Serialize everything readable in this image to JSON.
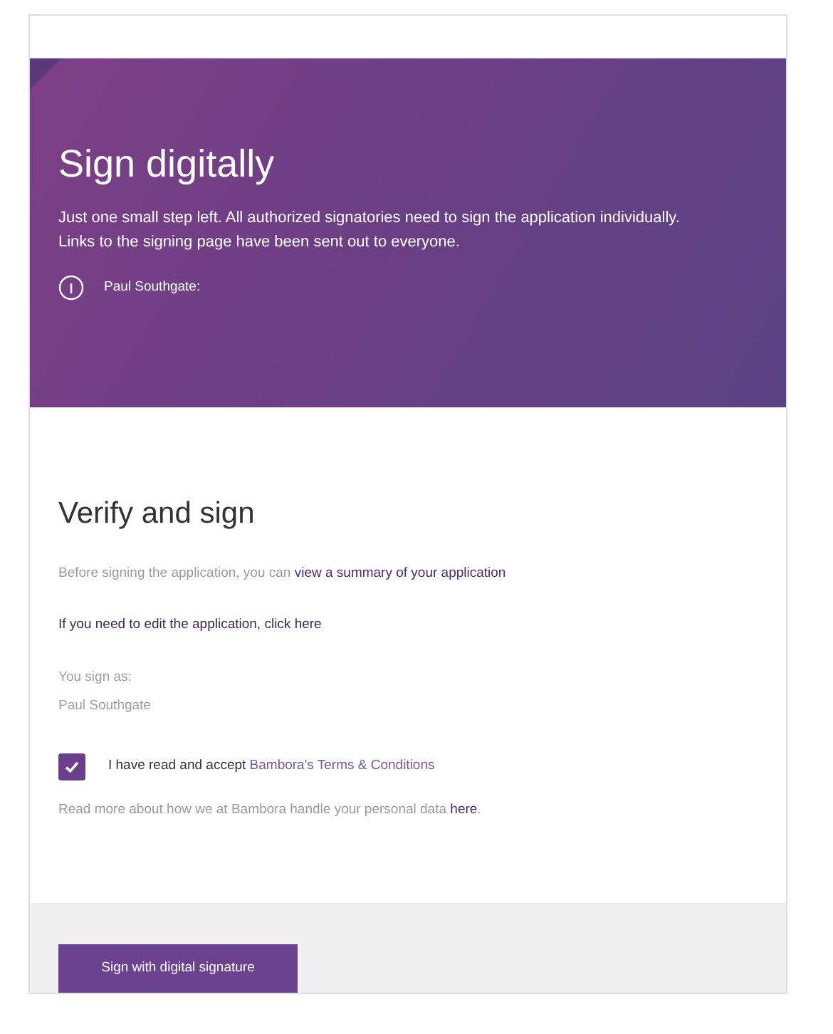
{
  "banner": {
    "title": "Sign digitally",
    "description": "Just one small step left. All authorized signatories need to sign the application individually. Links to the signing page have been sent out to everyone.",
    "signatories": [
      {
        "name": "Paul Southgate:"
      }
    ]
  },
  "verify": {
    "title": "Verify and sign",
    "summary": {
      "text": "Before signing the application, you can ",
      "link": "view a summary of your application"
    },
    "edit_link": "If you need to edit the application, click here",
    "sign_as_label": "You sign as:",
    "sign_as_name": "Paul Southgate",
    "terms": {
      "checked": true,
      "text": "I have read and accept ",
      "link": "Bambora's Terms & Conditions"
    },
    "privacy": {
      "text": "Read more about how we at Bambora handle your personal data ",
      "link": "here",
      "after": "."
    }
  },
  "footer": {
    "button": "Sign with digital signature"
  }
}
